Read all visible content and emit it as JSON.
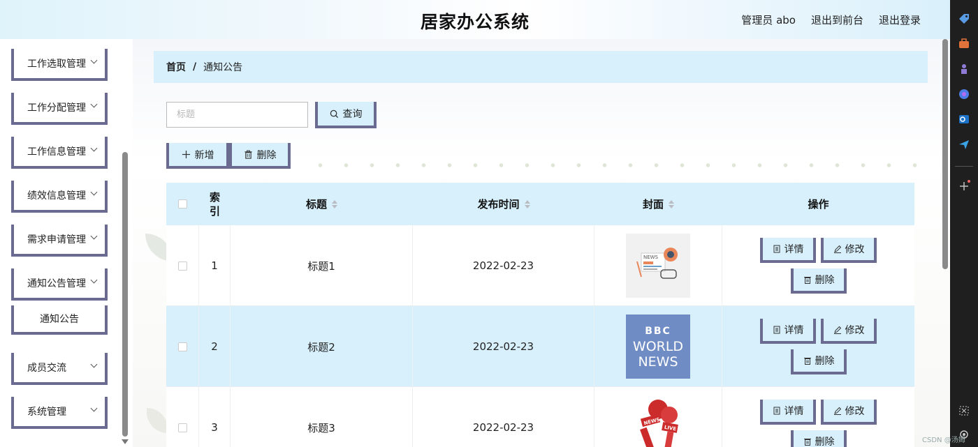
{
  "header": {
    "title": "居家办公系统",
    "user": "管理员 abo",
    "front": "退出到前台",
    "logout": "退出登录"
  },
  "sidebar": {
    "items": [
      {
        "label": "工作选取管理"
      },
      {
        "label": "工作分配管理"
      },
      {
        "label": "工作信息管理"
      },
      {
        "label": "绩效信息管理"
      },
      {
        "label": "需求申请管理"
      },
      {
        "label": "通知公告管理"
      },
      {
        "label": "通知公告"
      },
      {
        "label": "成员交流"
      },
      {
        "label": "系统管理"
      }
    ]
  },
  "breadcrumb": {
    "home": "首页",
    "sep": "/",
    "current": "通知公告"
  },
  "search": {
    "placeholder": "标题",
    "button": "查询"
  },
  "toolbar": {
    "add": "新增",
    "delete": "删除"
  },
  "table": {
    "headers": {
      "index": "索\n引",
      "title": "标题",
      "time": "发布时间",
      "cover": "封面",
      "ops": "操作"
    },
    "rows": [
      {
        "index": "1",
        "title": "标题1",
        "time": "2022-02-23",
        "cover": "news-illustration"
      },
      {
        "index": "2",
        "title": "标题2",
        "time": "2022-02-23",
        "cover": "bbc-world-news"
      },
      {
        "index": "3",
        "title": "标题3",
        "time": "2022-02-23",
        "cover": "news-microphones"
      }
    ],
    "ops": {
      "detail": "详情",
      "edit": "修改",
      "delete": "删除"
    }
  },
  "covers": {
    "bbc_logo": "BBC",
    "bbc_world": "WORLD",
    "bbc_news": "NEWS",
    "news_label": "NEWS",
    "live_label": "LIVE"
  },
  "watermark": "CSDN @汤姆",
  "colors": {
    "accent": "#d7f0fc",
    "border": "#6b6a91",
    "browser_bar": "#1f1f1f"
  }
}
